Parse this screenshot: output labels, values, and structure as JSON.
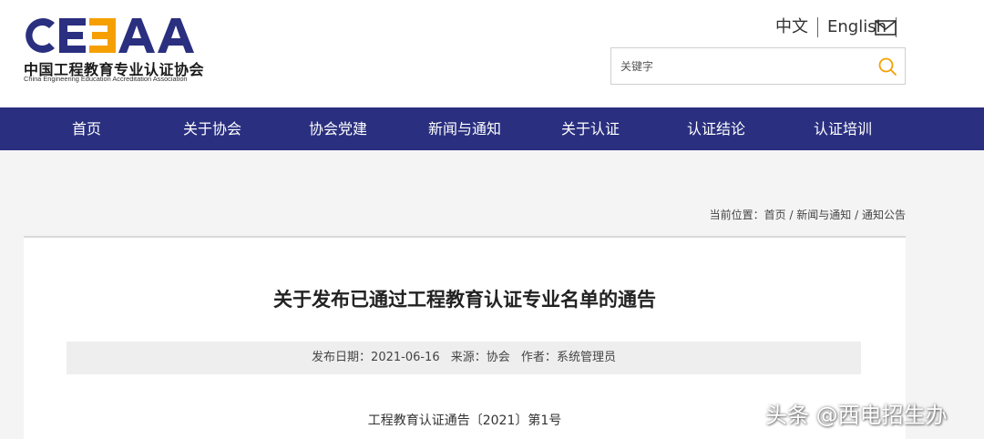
{
  "header": {
    "logo": {
      "mark_text": "CEEAA",
      "name_cn": "中国工程教育专业认证协会",
      "name_en": "China Engineering Education Accreditation Association",
      "colors": {
        "primary": "#2a2f7f",
        "accent": "#f5a000"
      }
    },
    "lang": {
      "zh": "中文",
      "en": "English"
    },
    "mail_icon": "mail-icon",
    "search": {
      "placeholder": "关键字",
      "value": "",
      "icon": "search-icon",
      "icon_color": "#f5a000"
    }
  },
  "nav": {
    "background": "#2a2f7f",
    "items": [
      {
        "label": "首页"
      },
      {
        "label": "关于协会"
      },
      {
        "label": "协会党建"
      },
      {
        "label": "新闻与通知"
      },
      {
        "label": "关于认证"
      },
      {
        "label": "认证结论"
      },
      {
        "label": "认证培训"
      }
    ]
  },
  "breadcrumb": {
    "prefix": "当前位置：",
    "items": [
      "首页",
      "新闻与通知",
      "通知公告"
    ],
    "separator": " / "
  },
  "article": {
    "title": "关于发布已通过工程教育认证专业名单的通告",
    "meta": {
      "date_label": "发布日期：",
      "date": "2021-06-16",
      "source_label": "来源：",
      "source": "协会",
      "author_label": "作者：",
      "author": "系统管理员"
    },
    "notice_number": "工程教育认证通告〔2021〕第1号"
  },
  "watermark": "头条 @西电招生办"
}
